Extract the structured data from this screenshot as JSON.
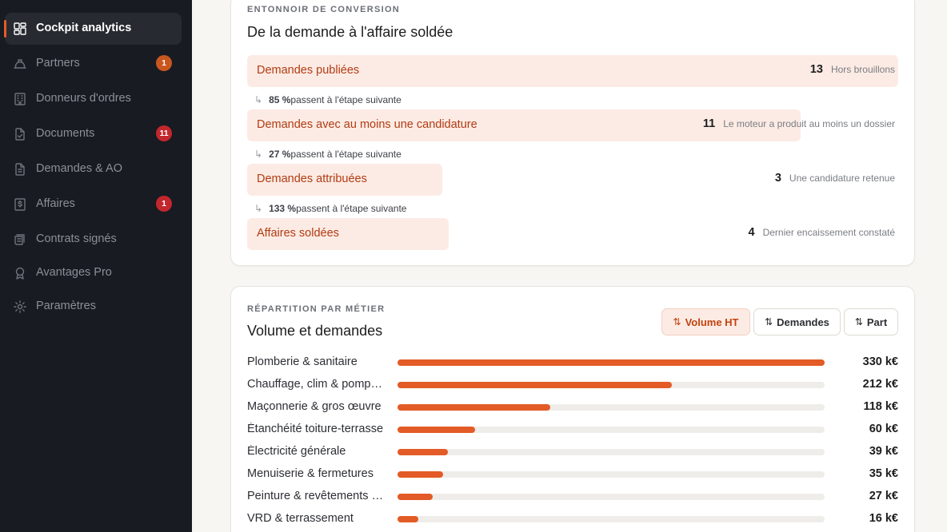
{
  "colors": {
    "accent": "#e35b26",
    "badge_warning": "#c9561f",
    "badge_danger": "#c2272d"
  },
  "sidebar": {
    "items": [
      {
        "label": "Cockpit analytics",
        "icon": "dashboard-icon",
        "active": true
      },
      {
        "label": "Partners",
        "icon": "hardhat-icon",
        "badge": "1",
        "badge_color": "warning"
      },
      {
        "label": "Donneurs d'ordres",
        "icon": "building-icon"
      },
      {
        "label": "Documents",
        "icon": "document-check-icon",
        "badge": "11",
        "badge_color": "danger"
      },
      {
        "label": "Demandes & AO",
        "icon": "file-text-icon"
      },
      {
        "label": "Affaires",
        "icon": "dollar-file-icon",
        "badge": "1",
        "badge_color": "danger"
      },
      {
        "label": "Contrats signés",
        "icon": "scroll-icon"
      },
      {
        "label": "Avantages Pro",
        "icon": "award-icon"
      },
      {
        "label": "Paramètres",
        "icon": "gear-icon"
      }
    ]
  },
  "funnel": {
    "eyebrow": "ENTONNOIR DE CONVERSION",
    "title": "De la demande à l'affaire soldée",
    "stages": [
      {
        "label": "Demandes publiées",
        "count": 13,
        "desc": "Hors brouillons",
        "share": 1.0
      },
      {
        "label": "Demandes avec au moins une candidature",
        "count": 11,
        "desc": "Le moteur a produit au moins un dossier",
        "share": 0.85
      },
      {
        "label": "Demandes attribuées",
        "count": 3,
        "desc": "Une candidature retenue",
        "share": 0.3
      },
      {
        "label": "Affaires soldées",
        "count": 4,
        "desc": "Dernier encaissement constaté",
        "share": 0.31
      }
    ],
    "steps": [
      {
        "arrow": "↳",
        "pct": "85 %",
        "text": "passent à l'étape suivante"
      },
      {
        "arrow": "↳",
        "pct": "27 %",
        "text": "passent à l'étape suivante"
      },
      {
        "arrow": "↳",
        "pct": "133 %",
        "text": "passent à l'étape suivante"
      }
    ]
  },
  "repartition": {
    "eyebrow": "RÉPARTITION PAR MÉTIER",
    "title": "Volume et demandes",
    "sort_icon": "⇅",
    "toggles": [
      {
        "label": "Volume HT",
        "active": true
      },
      {
        "label": "Demandes",
        "active": false
      },
      {
        "label": "Part",
        "active": false
      }
    ],
    "rows": [
      {
        "label": "Plomberie & sanitaire",
        "value": 330,
        "display": "330 k€"
      },
      {
        "label": "Chauffage, clim & pompes à chaleur",
        "value": 212,
        "display": "212 k€"
      },
      {
        "label": "Maçonnerie & gros œuvre",
        "value": 118,
        "display": "118 k€"
      },
      {
        "label": "Étanchéité toiture-terrasse",
        "value": 60,
        "display": "60 k€"
      },
      {
        "label": "Électricité générale",
        "value": 39,
        "display": "39 k€"
      },
      {
        "label": "Menuiserie & fermetures",
        "value": 35,
        "display": "35 k€"
      },
      {
        "label": "Peinture & revêtements muraux",
        "value": 27,
        "display": "27 k€"
      },
      {
        "label": "VRD & terrassement",
        "value": 16,
        "display": "16 k€"
      }
    ],
    "max": 330
  }
}
